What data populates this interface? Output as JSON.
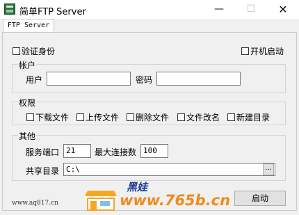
{
  "window": {
    "title": "简单FTP Server",
    "controls": {
      "minimize": "—",
      "maximize": "☐",
      "close": "✕"
    }
  },
  "tab": {
    "label": "FTP Server"
  },
  "options": {
    "auth_label": "验证身份",
    "auth_checked": false,
    "autostart_label": "开机启动",
    "autostart_checked": false
  },
  "account": {
    "title": "帐户",
    "user_label": "用户",
    "user_value": "",
    "password_label": "密码",
    "password_value": ""
  },
  "permissions": {
    "title": "权限",
    "items": [
      {
        "label": "下载文件",
        "checked": false
      },
      {
        "label": "上传文件",
        "checked": false
      },
      {
        "label": "删除文件",
        "checked": false
      },
      {
        "label": "文件改名",
        "checked": false
      },
      {
        "label": "新建目录",
        "checked": false
      }
    ]
  },
  "other": {
    "title": "其他",
    "port_label": "服务端口",
    "port_value": "21",
    "maxconn_label": "最大连接数",
    "maxconn_value": "100",
    "share_label": "共享目录",
    "share_value": "C:\\",
    "browse_label": "..."
  },
  "start_button": "启动",
  "watermark": {
    "site_left": "www.aq817.cn",
    "brand": "黑娃",
    "url": "www.765b.cn"
  }
}
